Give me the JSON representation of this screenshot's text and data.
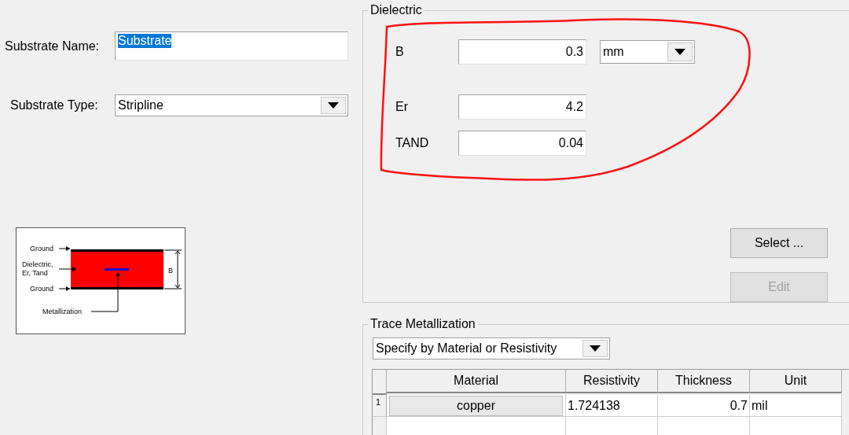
{
  "substrate_name": {
    "label": "Substrate Name:",
    "value": "Substrate",
    "selected": true
  },
  "substrate_type": {
    "label": "Substrate Type:",
    "value": "Stripline"
  },
  "diagram": {
    "ground_top": "Ground",
    "dielectric": [
      "Dielectric,",
      "Er, Tand"
    ],
    "ground_bottom": "Ground",
    "metallization": "Metallization",
    "dimension": "B"
  },
  "dielectric": {
    "title": "Dielectric",
    "fields": [
      {
        "label": "B",
        "value": "0.3",
        "unit": "mm"
      },
      {
        "label": "Er",
        "value": "4.2"
      },
      {
        "label": "TAND",
        "value": "0.04"
      }
    ],
    "buttons": [
      {
        "label": "Select ...",
        "disabled": false
      },
      {
        "label": "Edit",
        "disabled": true
      }
    ]
  },
  "trace_metallization": {
    "title": "Trace Metallization",
    "mode": "Specify by Material or Resistivity",
    "columns": [
      "Material",
      "Resistivity",
      "Thickness",
      "Unit"
    ],
    "rows": [
      {
        "number": "1",
        "cells": [
          "copper",
          "1.724138",
          "0.7",
          "mil"
        ]
      }
    ]
  }
}
